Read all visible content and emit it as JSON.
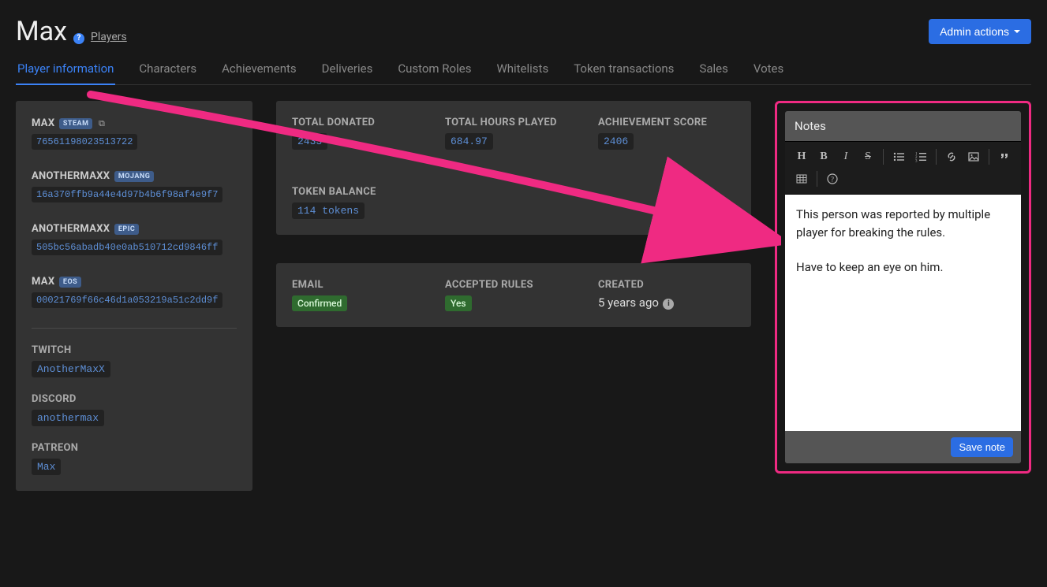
{
  "header": {
    "title": "Max",
    "breadcrumb": "Players",
    "admin_actions": "Admin actions"
  },
  "tabs": [
    "Player information",
    "Characters",
    "Achievements",
    "Deliveries",
    "Custom Roles",
    "Whitelists",
    "Token transactions",
    "Sales",
    "Votes"
  ],
  "identities": [
    {
      "name": "MAX",
      "platform": "STEAM",
      "id": "76561198023513722",
      "external": true
    },
    {
      "name": "ANOTHERMAXX",
      "platform": "MOJANG",
      "id": "16a370ffb9a44e4d97b4b6f98af4e9f7",
      "external": false
    },
    {
      "name": "ANOTHERMAXX",
      "platform": "EPIC",
      "id": "505bc56abadb40e0ab510712cd9846ff",
      "external": false
    },
    {
      "name": "MAX",
      "platform": "EOS",
      "id": "00021769f66c46d1a053219a51c2dd9f",
      "external": false
    }
  ],
  "socials": {
    "twitch_label": "TWITCH",
    "twitch": "AnotherMaxX",
    "discord_label": "DISCORD",
    "discord": "anothermax",
    "patreon_label": "PATREON",
    "patreon": "Max"
  },
  "stats": {
    "donated_label": "TOTAL DONATED",
    "donated": "2433",
    "hours_label": "TOTAL HOURS PLAYED",
    "hours": "684.97",
    "score_label": "ACHIEVEMENT SCORE",
    "score": "2406",
    "tokens_label": "TOKEN BALANCE",
    "tokens": "114 tokens"
  },
  "info": {
    "email_label": "EMAIL",
    "email": "Confirmed",
    "rules_label": "ACCEPTED RULES",
    "rules": "Yes",
    "created_label": "CREATED",
    "created": "5 years ago"
  },
  "notes": {
    "title": "Notes",
    "body_p1": "This person was reported by multiple player for breaking the rules.",
    "body_p2": "Have to keep an eye on him.",
    "save": "Save note"
  }
}
